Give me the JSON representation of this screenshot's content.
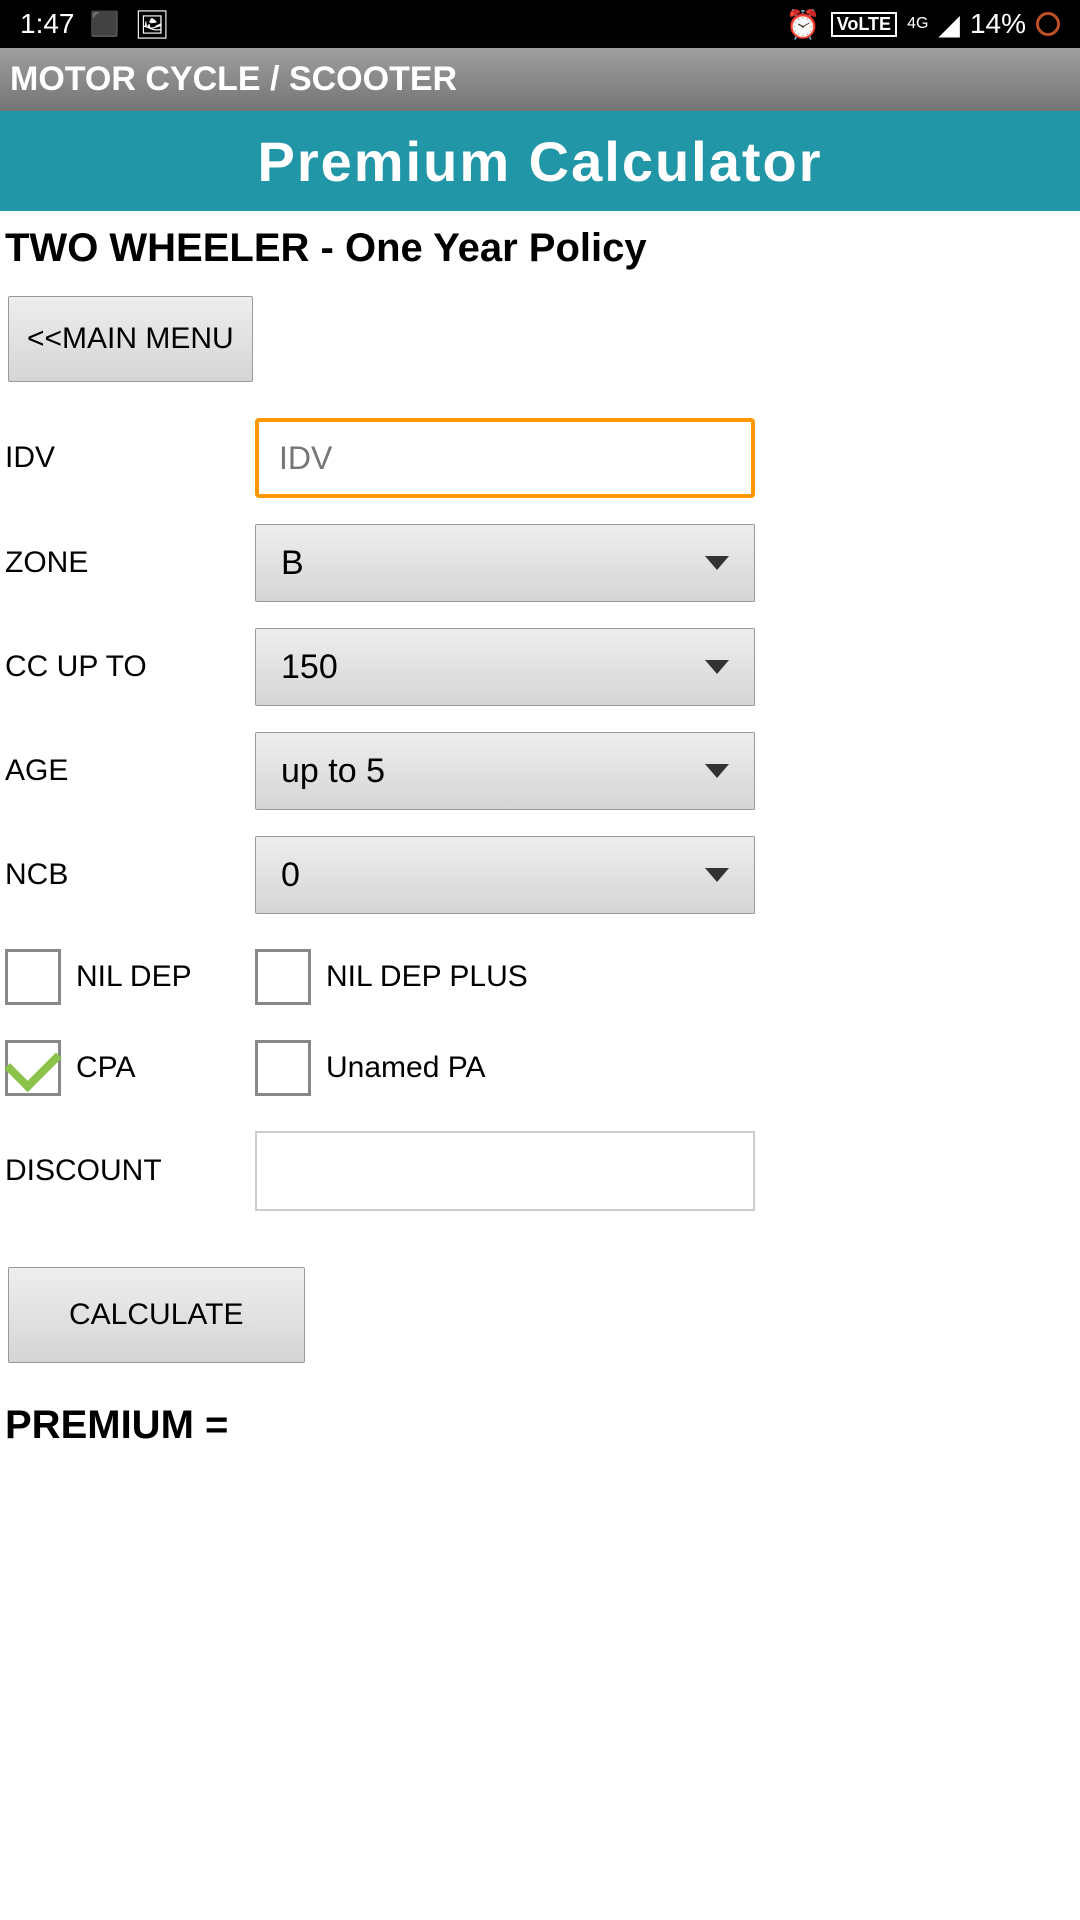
{
  "status_bar": {
    "time": "1:47",
    "battery_pct": "14%",
    "volte": "VoLTE",
    "network": "4G"
  },
  "header": {
    "title": "MOTOR CYCLE / SCOOTER"
  },
  "banner": {
    "title": "Premium Calculator"
  },
  "page": {
    "title": "TWO WHEELER - One Year Policy",
    "main_menu_btn": "<<MAIN MENU",
    "calculate_btn": "CALCULATE",
    "premium_label": "PREMIUM ="
  },
  "form": {
    "idv": {
      "label": "IDV",
      "placeholder": "IDV",
      "value": ""
    },
    "zone": {
      "label": "ZONE",
      "value": "B"
    },
    "cc": {
      "label": "CC UP TO",
      "value": "150"
    },
    "age": {
      "label": "AGE",
      "value": "up to 5"
    },
    "ncb": {
      "label": "NCB",
      "value": "0"
    },
    "discount": {
      "label": "DISCOUNT",
      "value": ""
    }
  },
  "checkboxes": {
    "nil_dep": {
      "label": "NIL DEP",
      "checked": false
    },
    "nil_dep_plus": {
      "label": "NIL DEP PLUS",
      "checked": false
    },
    "cpa": {
      "label": "CPA",
      "checked": true
    },
    "unnamed_pa": {
      "label": "Unamed PA",
      "checked": false
    }
  }
}
